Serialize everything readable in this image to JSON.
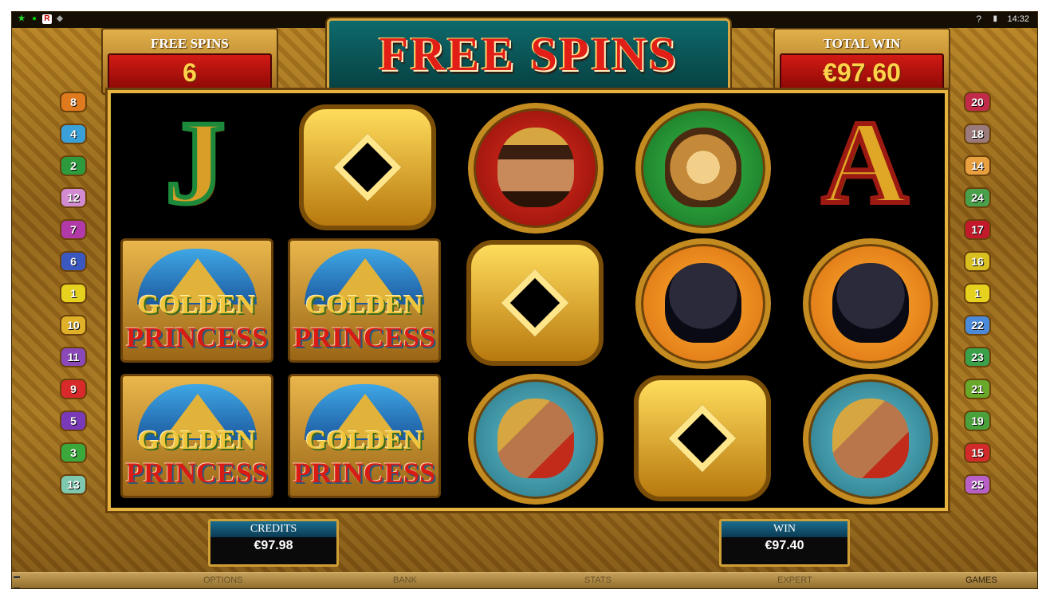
{
  "status_bar": {
    "time": "14:32",
    "help": "?",
    "signal": "▮",
    "icons": [
      "R",
      "◆",
      "●",
      "★"
    ]
  },
  "header": {
    "title": "FREE SPINS",
    "free_spins_label": "FREE SPINS",
    "free_spins_value": "6",
    "total_win_label": "TOTAL WIN",
    "total_win_value": "€97.60"
  },
  "reels": [
    [
      "J",
      "Golden Princess",
      "Golden Princess"
    ],
    [
      "Q",
      "Golden Princess",
      "Golden Princess"
    ],
    [
      "Princess",
      "Q",
      "Warrior"
    ],
    [
      "Jaguar",
      "Panther",
      "Q"
    ],
    [
      "A",
      "Panther",
      "Warrior"
    ]
  ],
  "logo": {
    "line1": "GOLDEN",
    "line2": "PRINCESS"
  },
  "paylines_left": [
    "8",
    "4",
    "2",
    "12",
    "7",
    "6",
    "1",
    "10",
    "11",
    "9",
    "5",
    "3",
    "13"
  ],
  "paylines_right": [
    "20",
    "18",
    "14",
    "24",
    "17",
    "16",
    "1",
    "22",
    "23",
    "21",
    "19",
    "15",
    "25"
  ],
  "payline_colors_left": [
    "#e07a1e",
    "#3aa0d8",
    "#2e9a3e",
    "#d28ad0",
    "#b23aa8",
    "#3a58c0",
    "#e6d21e",
    "#e0b028",
    "#8a48b8",
    "#d82a2a",
    "#7a3ab8",
    "#3aa83a",
    "#7fc8b0"
  ],
  "payline_colors_right": [
    "#c22a4a",
    "#9a7a7a",
    "#e8a040",
    "#4aa04a",
    "#c21a2a",
    "#d8c020",
    "#e6d21e",
    "#4a8ad8",
    "#3aa04a",
    "#6aa82a",
    "#4aa03a",
    "#d22a2a",
    "#b860c8"
  ],
  "credits": {
    "label": "CREDITS",
    "value": "€97.98"
  },
  "win": {
    "label": "WIN",
    "value": "€97.40"
  },
  "bottom_menu": [
    "OPTIONS",
    "BANK",
    "STATS",
    "EXPERT",
    "GAMES"
  ]
}
